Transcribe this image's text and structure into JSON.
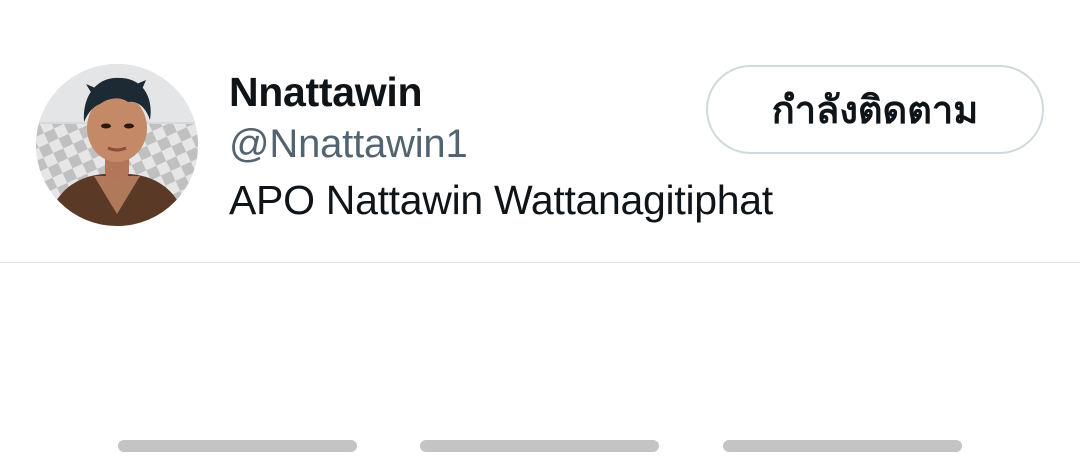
{
  "user": {
    "display_name": "Nnattawin",
    "handle": "@Nnattawin1",
    "bio": "APO Nattawin Wattanagitiphat",
    "avatar": "profile-photo"
  },
  "follow_button": {
    "label": "กำลังติดตาม"
  },
  "placeholders": {
    "count": 3
  },
  "colors": {
    "text_primary": "#0f1419",
    "text_secondary": "#536471",
    "button_border": "#cfd9de",
    "divider": "#e3e6e8",
    "skeleton": "#c4c4c4"
  }
}
